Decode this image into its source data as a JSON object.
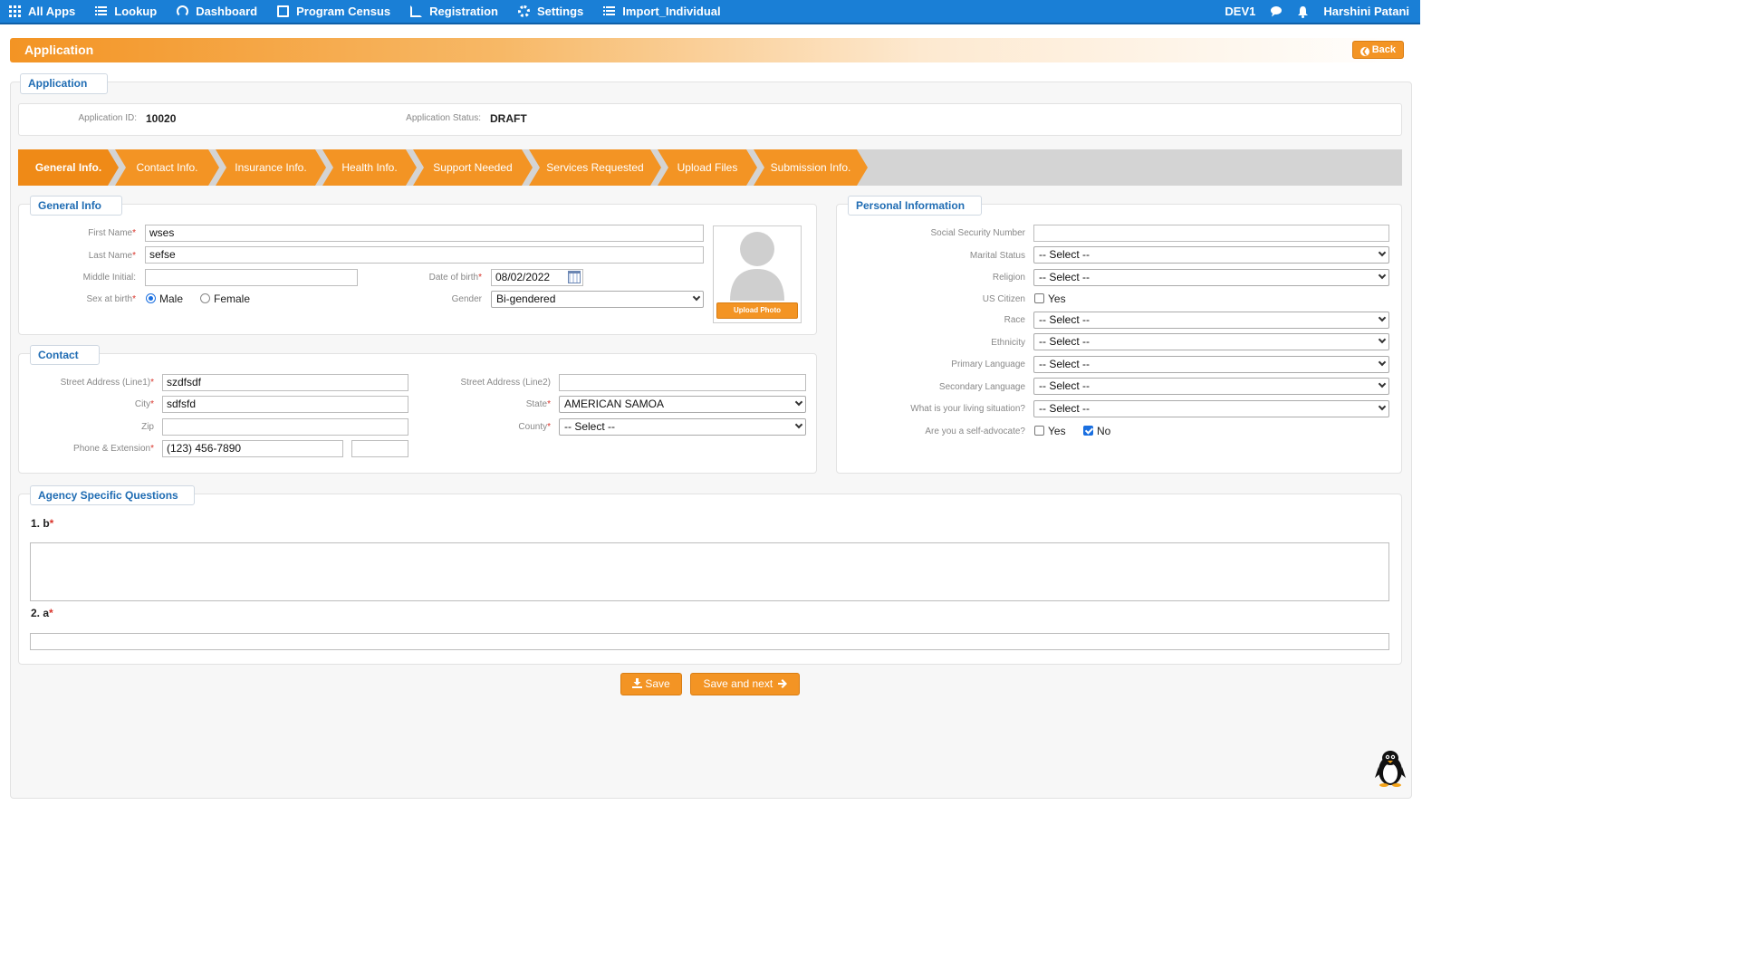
{
  "nav": {
    "items": [
      {
        "label": "All Apps",
        "icon": "grid-icon"
      },
      {
        "label": "Lookup",
        "icon": "list-icon"
      },
      {
        "label": "Dashboard",
        "icon": "dashboard-icon"
      },
      {
        "label": "Program Census",
        "icon": "document-icon"
      },
      {
        "label": "Registration",
        "icon": "edit-icon"
      },
      {
        "label": "Settings",
        "icon": "gear-icon"
      },
      {
        "label": "Import_Individual",
        "icon": "list-icon"
      }
    ],
    "env": "DEV1",
    "user": "Harshini Patani"
  },
  "titlebar": {
    "title": "Application",
    "back_label": "Back"
  },
  "application": {
    "section_label": "Application",
    "id_label": "Application ID:",
    "id_value": "10020",
    "status_label": "Application Status:",
    "status_value": "DRAFT"
  },
  "wizard": {
    "steps": [
      "General Info.",
      "Contact Info.",
      "Insurance Info.",
      "Health Info.",
      "Support Needed",
      "Services Requested",
      "Upload Files",
      "Submission Info."
    ],
    "active": "General Info."
  },
  "general": {
    "section_label": "General Info",
    "first_name_label": "First Name",
    "first_name": "wses",
    "last_name_label": "Last Name",
    "last_name": "sefse",
    "middle_initial_label": "Middle Initial:",
    "middle_initial": "",
    "dob_label": "Date of birth",
    "dob": "08/02/2022",
    "sex_label": "Sex at birth",
    "sex_options": [
      "Male",
      "Female"
    ],
    "sex_selected": "Male",
    "gender_label": "Gender",
    "gender": "Bi-gendered",
    "upload_photo_label": "Upload Photo"
  },
  "contact": {
    "section_label": "Contact",
    "street1_label": "Street Address (Line1)",
    "street1": "szdfsdf",
    "street2_label": "Street Address (Line2)",
    "street2": "",
    "city_label": "City",
    "city": "sdfsfd",
    "state_label": "State",
    "state": "AMERICAN SAMOA",
    "zip_label": "Zip",
    "zip": "",
    "county_label": "County",
    "county": "-- Select --",
    "phone_label": "Phone & Extension",
    "phone": "(123) 456-7890",
    "extension": ""
  },
  "personal": {
    "section_label": "Personal Information",
    "ssn_label": "Social Security Number",
    "ssn": "",
    "marital_label": "Marital Status",
    "marital": "-- Select --",
    "religion_label": "Religion",
    "religion": "-- Select --",
    "citizen_label": "US Citizen",
    "citizen_yes_label": "Yes",
    "race_label": "Race",
    "race": "-- Select --",
    "ethnicity_label": "Ethnicity",
    "ethnicity": "-- Select --",
    "primary_lang_label": "Primary Language",
    "primary_lang": "-- Select --",
    "secondary_lang_label": "Secondary Language",
    "secondary_lang": "-- Select --",
    "living_label": "What is your living situation?",
    "living": "-- Select --",
    "self_advocate_label": "Are you a self-advocate?",
    "self_advocate_yes": "Yes",
    "self_advocate_no": "No",
    "self_advocate_selected": "No"
  },
  "agency": {
    "section_label": "Agency Specific Questions",
    "q1_label": "1. b",
    "q1_value": "",
    "q2_label": "2. a",
    "q2_value": ""
  },
  "actions": {
    "save_label": "Save",
    "save_next_label": "Save and next"
  },
  "colors": {
    "nav_blue": "#1a7fd6",
    "accent_orange": "#f39424",
    "link_blue": "#1f6cb3"
  }
}
